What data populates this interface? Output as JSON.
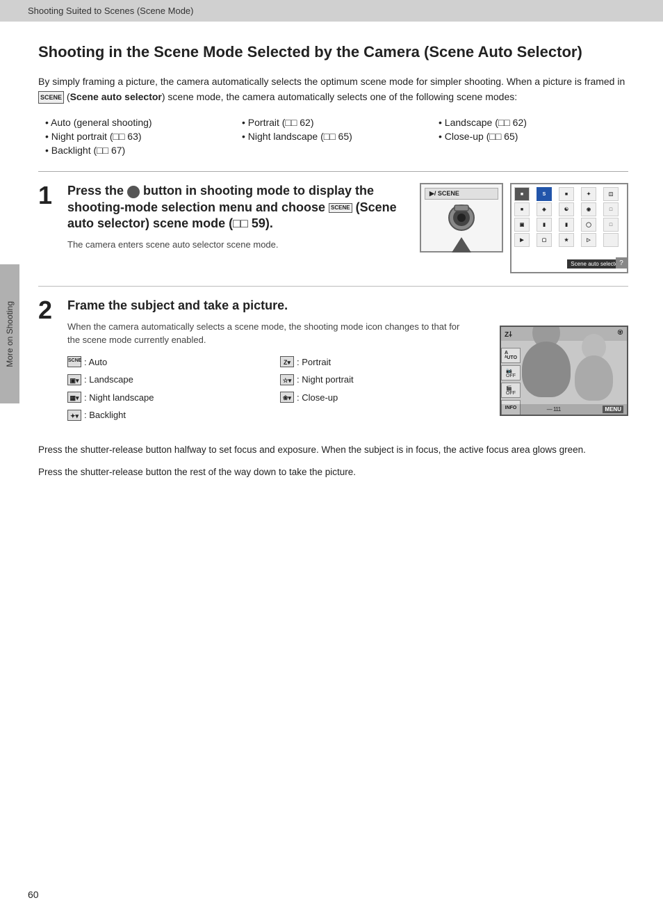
{
  "topbar": {
    "label": "Shooting Suited to Scenes (Scene Mode)"
  },
  "sidebar": {
    "label": "More on Shooting"
  },
  "page": {
    "title": "Shooting in the Scene Mode Selected by the Camera (Scene Auto Selector)",
    "intro": "By simply framing a picture, the camera automatically selects the optimum scene mode for simpler shooting. When a picture is framed in",
    "intro_bold": "(Scene auto selector)",
    "intro_end": "scene mode, the camera automatically selects one of the following scene modes:",
    "icon_label": "SCENE"
  },
  "bullet_items": [
    {
      "text": "Auto (general shooting)",
      "col": 1
    },
    {
      "text": "Portrait (",
      "ref": "62",
      "suffix": ")",
      "col": 2
    },
    {
      "text": "Landscape (",
      "ref": "62",
      "suffix": ")",
      "col": 3
    },
    {
      "text": "Night portrait (",
      "ref": "63",
      "suffix": ")",
      "col": 1
    },
    {
      "text": "Night landscape (",
      "ref": "65",
      "suffix": ")",
      "col": 2
    },
    {
      "text": "Close-up (",
      "ref": "65",
      "suffix": ")",
      "col": 3
    },
    {
      "text": "Backlight (",
      "ref": "67",
      "suffix": ")",
      "col": 1
    }
  ],
  "step1": {
    "number": "1",
    "title": "Press the  button in shooting mode to display the shooting-mode selection menu and choose  (Scene auto selector) scene mode ( 59).",
    "title_camera_icon": "🎥",
    "title_bold": "(Scene auto selector)",
    "title_ref": "59",
    "desc": "The camera enters scene auto selector scene mode.",
    "screen1_label": "▶/ SCENE",
    "screen2_label": "Scene auto selector"
  },
  "step2": {
    "number": "2",
    "title": "Frame the subject and take a picture.",
    "desc": "When the camera automatically selects a scene mode, the shooting mode icon changes to that for the scene mode currently enabled.",
    "icons": [
      {
        "symbol": "SCNE",
        "label": ": Auto"
      },
      {
        "symbol": "Z▾",
        "label": ": Portrait"
      },
      {
        "symbol": "▣▾",
        "label": ": Landscape"
      },
      {
        "symbol": "☆▾",
        "label": ": Night portrait"
      },
      {
        "symbol": "▦▾",
        "label": ": Night landscape"
      },
      {
        "symbol": "❀▾",
        "label": ": Close-up"
      },
      {
        "symbol": "✦▾",
        "label": ": Backlight"
      }
    ],
    "bottom1": "Press the shutter-release button halfway to set focus and exposure. When the subject is in focus, the active focus area glows green.",
    "bottom2": "Press the shutter-release button the rest of the way down to take the picture."
  },
  "page_number": "60"
}
